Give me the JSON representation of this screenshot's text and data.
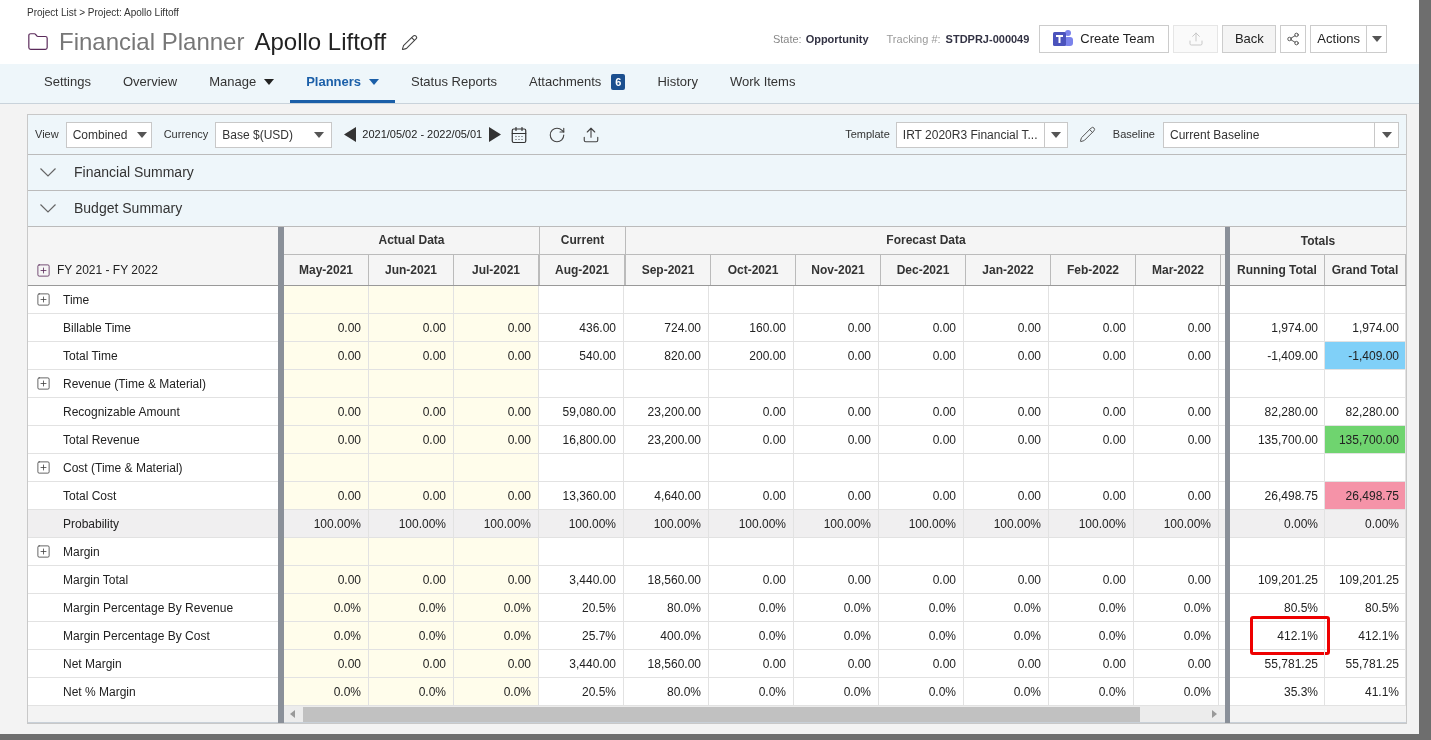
{
  "breadcrumb": "Project List > Project: Apollo Liftoff",
  "header": {
    "module": "Financial Planner",
    "project": "Apollo Liftoff",
    "state_label": "State:",
    "state": "Opportunity",
    "tracking_label": "Tracking #:",
    "tracking": "STDPRJ-000049",
    "create_team": "Create Team",
    "export_disabled": true,
    "back": "Back",
    "actions": "Actions"
  },
  "tabs": [
    {
      "label": "Settings",
      "selected": false
    },
    {
      "label": "Overview",
      "selected": false
    },
    {
      "label": "Manage",
      "selected": false,
      "dropdown": true
    },
    {
      "label": "Planners",
      "selected": true,
      "dropdown": true
    },
    {
      "label": "Status Reports",
      "selected": false
    },
    {
      "label": "Attachments",
      "selected": false,
      "badge": "6"
    },
    {
      "label": "History",
      "selected": false
    },
    {
      "label": "Work Items",
      "selected": false
    }
  ],
  "toolbar": {
    "view_label": "View",
    "view": "Combined",
    "currency_label": "Currency",
    "currency": "Base $(USD)",
    "date_range": "2021/05/02 - 2022/05/01",
    "template_label": "Template",
    "template": "IRT 2020R3 Financial T...",
    "baseline_label": "Baseline",
    "baseline": "Current Baseline"
  },
  "sections": [
    {
      "title": "Financial Summary"
    },
    {
      "title": "Budget Summary"
    }
  ],
  "table": {
    "period": "FY 2021 - FY 2022",
    "groups": [
      {
        "title": "Actual Data",
        "kind": "actual",
        "months": [
          "May-2021",
          "Jun-2021",
          "Jul-2021"
        ]
      },
      {
        "title": "Current",
        "kind": "current",
        "months": [
          "Aug-2021"
        ]
      },
      {
        "title": "Forecast Data",
        "kind": "forecast",
        "months": [
          "Sep-2021",
          "Oct-2021",
          "Nov-2021",
          "Dec-2021",
          "Jan-2022",
          "Feb-2022",
          "Mar-2022"
        ]
      }
    ],
    "totals_title": "Totals",
    "totals_columns": [
      "Running Total",
      "Grand Total"
    ],
    "rows": [
      {
        "kind": "group",
        "label": "Time"
      },
      {
        "kind": "item",
        "label": "Billable Time",
        "values": [
          "0.00",
          "0.00",
          "0.00",
          "436.00",
          "724.00",
          "160.00",
          "0.00",
          "0.00",
          "0.00",
          "0.00",
          "0.00"
        ],
        "totals": [
          {
            "value": "1,974.00"
          },
          {
            "value": "1,974.00"
          }
        ]
      },
      {
        "kind": "item",
        "label": "Total Time",
        "values": [
          "0.00",
          "0.00",
          "0.00",
          "540.00",
          "820.00",
          "200.00",
          "0.00",
          "0.00",
          "0.00",
          "0.00",
          "0.00"
        ],
        "totals": [
          {
            "value": "-1,409.00"
          },
          {
            "value": "-1,409.00",
            "color": "#80d0f8"
          }
        ]
      },
      {
        "kind": "group",
        "label": "Revenue (Time & Material)"
      },
      {
        "kind": "item",
        "label": "Recognizable Amount",
        "values": [
          "0.00",
          "0.00",
          "0.00",
          "59,080.00",
          "23,200.00",
          "0.00",
          "0.00",
          "0.00",
          "0.00",
          "0.00",
          "0.00"
        ],
        "totals": [
          {
            "value": "82,280.00"
          },
          {
            "value": "82,280.00"
          }
        ]
      },
      {
        "kind": "item",
        "label": "Total Revenue",
        "values": [
          "0.00",
          "0.00",
          "0.00",
          "16,800.00",
          "23,200.00",
          "0.00",
          "0.00",
          "0.00",
          "0.00",
          "0.00",
          "0.00"
        ],
        "totals": [
          {
            "value": "135,700.00"
          },
          {
            "value": "135,700.00",
            "color": "#6fd46f"
          }
        ]
      },
      {
        "kind": "group",
        "label": "Cost (Time & Material)"
      },
      {
        "kind": "item",
        "label": "Total Cost",
        "values": [
          "0.00",
          "0.00",
          "0.00",
          "13,360.00",
          "4,640.00",
          "0.00",
          "0.00",
          "0.00",
          "0.00",
          "0.00",
          "0.00"
        ],
        "totals": [
          {
            "value": "26,498.75"
          },
          {
            "value": "26,498.75",
            "color": "#f593a8"
          }
        ]
      },
      {
        "kind": "summary",
        "label": "Probability",
        "values": [
          "100.00%",
          "100.00%",
          "100.00%",
          "100.00%",
          "100.00%",
          "100.00%",
          "100.00%",
          "100.00%",
          "100.00%",
          "100.00%",
          "100.00%"
        ],
        "totals": [
          {
            "value": "0.00%"
          },
          {
            "value": "0.00%"
          }
        ]
      },
      {
        "kind": "group",
        "label": "Margin"
      },
      {
        "kind": "item",
        "label": "Margin Total",
        "values": [
          "0.00",
          "0.00",
          "0.00",
          "3,440.00",
          "18,560.00",
          "0.00",
          "0.00",
          "0.00",
          "0.00",
          "0.00",
          "0.00"
        ],
        "totals": [
          {
            "value": "109,201.25"
          },
          {
            "value": "109,201.25"
          }
        ]
      },
      {
        "kind": "item",
        "label": "Margin Percentage By Revenue",
        "values": [
          "0.0%",
          "0.0%",
          "0.0%",
          "20.5%",
          "80.0%",
          "0.0%",
          "0.0%",
          "0.0%",
          "0.0%",
          "0.0%",
          "0.0%"
        ],
        "totals": [
          {
            "value": "80.5%"
          },
          {
            "value": "80.5%"
          }
        ]
      },
      {
        "kind": "item",
        "label": "Margin Percentage By Cost",
        "values": [
          "0.0%",
          "0.0%",
          "0.0%",
          "25.7%",
          "400.0%",
          "0.0%",
          "0.0%",
          "0.0%",
          "0.0%",
          "0.0%",
          "0.0%"
        ],
        "totals": [
          {
            "value": "412.1%",
            "highlighted": true
          },
          {
            "value": "412.1%"
          }
        ]
      },
      {
        "kind": "item",
        "label": "Net Margin",
        "values": [
          "0.00",
          "0.00",
          "0.00",
          "3,440.00",
          "18,560.00",
          "0.00",
          "0.00",
          "0.00",
          "0.00",
          "0.00",
          "0.00"
        ],
        "totals": [
          {
            "value": "55,781.25"
          },
          {
            "value": "55,781.25"
          }
        ]
      },
      {
        "kind": "item",
        "label": "Net % Margin",
        "values": [
          "0.0%",
          "0.0%",
          "0.0%",
          "20.5%",
          "80.0%",
          "0.0%",
          "0.0%",
          "0.0%",
          "0.0%",
          "0.0%",
          "0.0%"
        ],
        "totals": [
          {
            "value": "35.3%"
          },
          {
            "value": "41.1%"
          }
        ]
      }
    ]
  }
}
